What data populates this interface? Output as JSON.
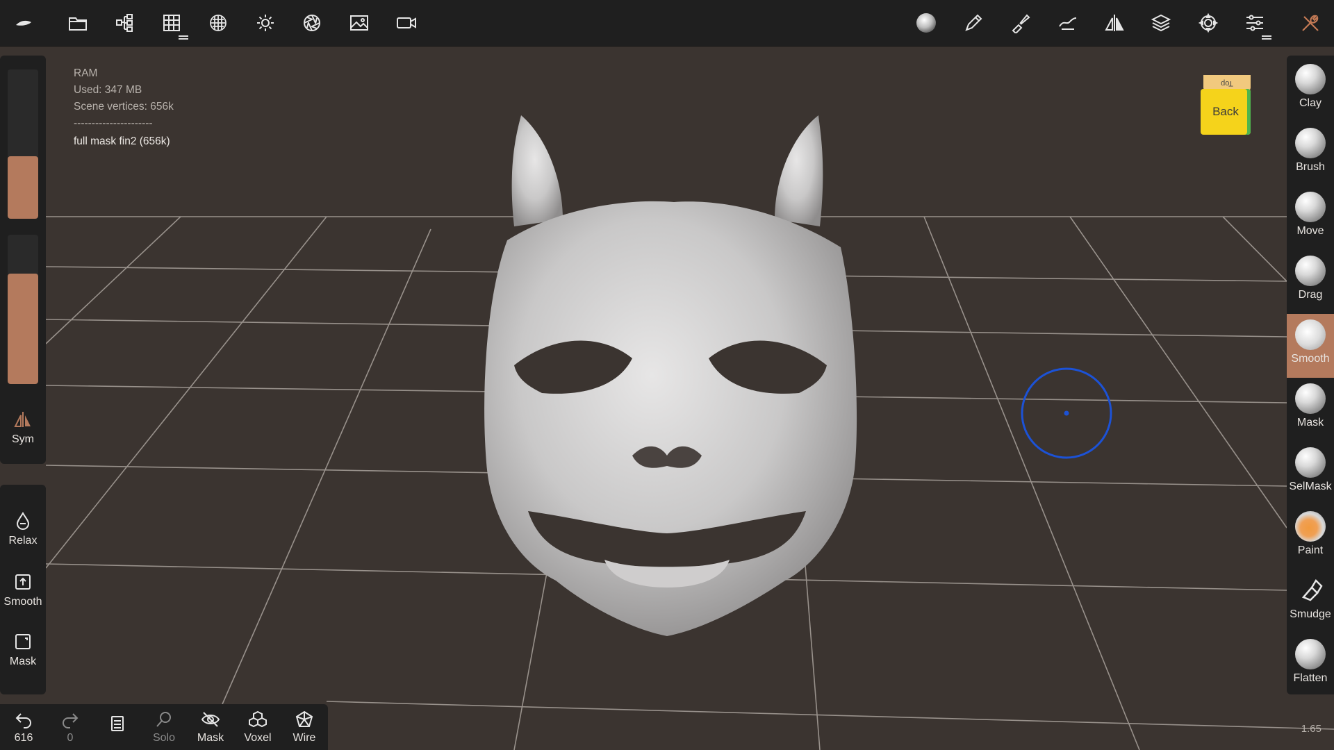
{
  "top_toolbar": {
    "left_icons": [
      "app-logo-icon",
      "folder-icon",
      "scene-tree-icon",
      "grid-icon",
      "topology-icon",
      "sun-icon",
      "aperture-icon",
      "image-icon",
      "video-camera-icon"
    ],
    "right_icons": [
      "material-sphere-icon",
      "pencil-icon",
      "paint-brush-icon",
      "brush-stroke-icon",
      "symmetry-icon",
      "layers-icon",
      "gear-icon",
      "sliders-icon",
      "wrench-icon"
    ]
  },
  "info": {
    "ram_label": "RAM",
    "used": "Used: 347 MB",
    "vertices": "Scene vertices: 656k",
    "separator": "----------------------",
    "object_name": "full mask fin2 (656k)"
  },
  "view_cube": {
    "top_label": "Top",
    "front_label": "Back"
  },
  "left_panel": {
    "radius_fraction": 0.42,
    "intensity_fraction": 0.74,
    "sym_label": "Sym",
    "actions": [
      {
        "label": "Relax",
        "icon": "droplet-icon"
      },
      {
        "label": "Smooth",
        "icon": "smooth-box-icon"
      },
      {
        "label": "Mask",
        "icon": "mask-box-icon"
      }
    ]
  },
  "tools": [
    {
      "label": "Clay",
      "active": false
    },
    {
      "label": "Brush",
      "active": false
    },
    {
      "label": "Move",
      "active": false
    },
    {
      "label": "Drag",
      "active": false
    },
    {
      "label": "Smooth",
      "active": true
    },
    {
      "label": "Mask",
      "active": false
    },
    {
      "label": "SelMask",
      "active": false
    },
    {
      "label": "Paint",
      "active": false
    },
    {
      "label": "Smudge",
      "active": false
    },
    {
      "label": "Flatten",
      "active": false
    }
  ],
  "bottom_bar": {
    "undo_count": "616",
    "redo_count": "0",
    "solo_label": "Solo",
    "mask_label": "Mask",
    "voxel_label": "Voxel",
    "wire_label": "Wire"
  },
  "zoom_value": "1.65",
  "colors": {
    "accent": "#b47a5d",
    "panel": "#1f1f1f",
    "cursor": "#1c52d6"
  }
}
